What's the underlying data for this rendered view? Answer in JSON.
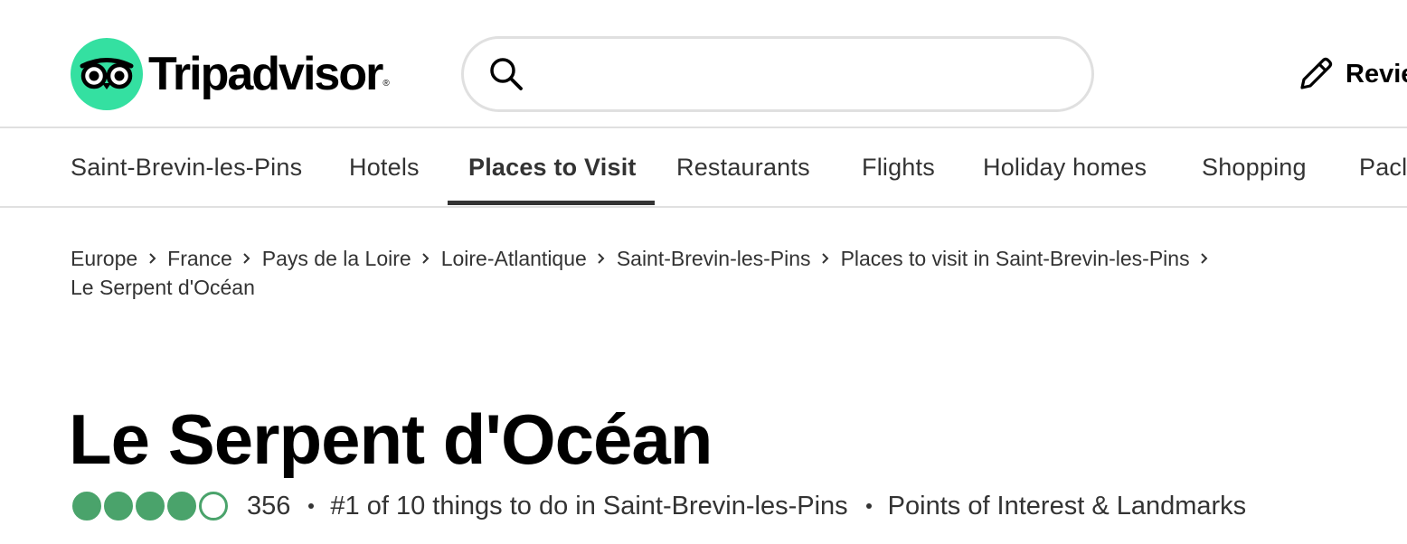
{
  "header": {
    "brand": "Tripadvisor",
    "brand_mark": "®",
    "brand_color": "#34e0a1",
    "logo_icon": "owl-eyes-icon",
    "search": {
      "value": "",
      "placeholder": "",
      "icon": "search-icon"
    },
    "review_link": {
      "label": "Revie",
      "icon": "pencil-icon"
    }
  },
  "nav": {
    "items": [
      {
        "label": "Saint-Brevin-les-Pins",
        "active": false
      },
      {
        "label": "Hotels",
        "active": false
      },
      {
        "label": "Places to Visit",
        "active": true
      },
      {
        "label": "Restaurants",
        "active": false
      },
      {
        "label": "Flights",
        "active": false
      },
      {
        "label": "Holiday homes",
        "active": false
      },
      {
        "label": "Shopping",
        "active": false
      },
      {
        "label": "Pacl",
        "active": false
      }
    ]
  },
  "breadcrumb": {
    "items": [
      "Europe",
      "France",
      "Pays de la Loire",
      "Loire-Atlantique",
      "Saint-Brevin-les-Pins",
      "Places to visit in Saint-Brevin-les-Pins",
      "Le Serpent d'Océan"
    ],
    "separator_icon": "chevron-right-icon"
  },
  "attraction": {
    "title": "Le Serpent d'Océan",
    "rating": 4,
    "rating_max": 5,
    "rating_color": "#4aa36b",
    "review_count": "356",
    "rank": "#1 of 10 things to do in Saint-Brevin-les-Pins",
    "category": "Points of Interest & Landmarks"
  }
}
